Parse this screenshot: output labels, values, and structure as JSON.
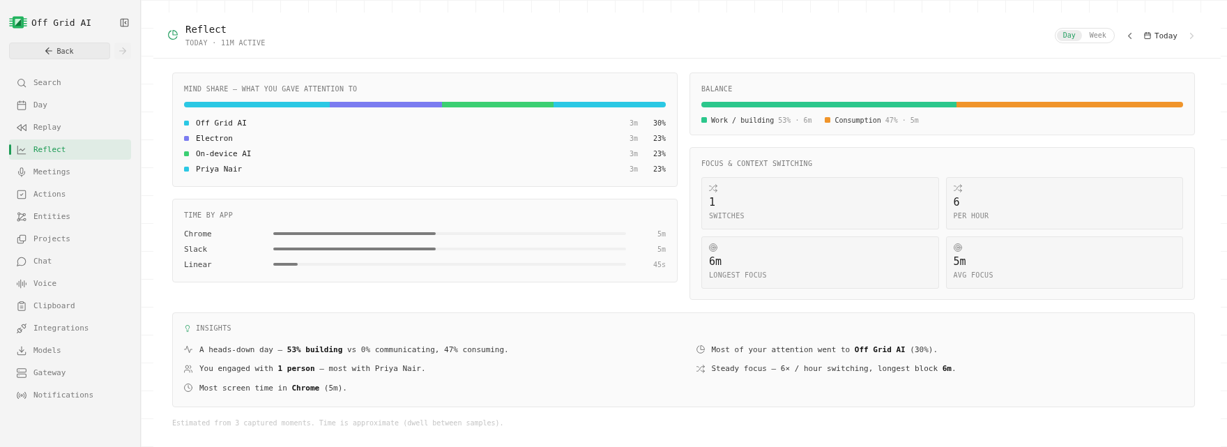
{
  "sidebar": {
    "app_name": "Off Grid AI",
    "back_button": {
      "label": "Back",
      "disabled": false
    },
    "forward_button": {
      "disabled": true
    },
    "items": [
      {
        "label": "Search",
        "selected": false
      },
      {
        "label": "Day",
        "selected": false
      },
      {
        "label": "Replay",
        "selected": false
      },
      {
        "label": "Reflect",
        "selected": true
      },
      {
        "label": "Meetings",
        "selected": false
      },
      {
        "label": "Actions",
        "selected": false
      },
      {
        "label": "Entities",
        "selected": false
      },
      {
        "label": "Projects",
        "selected": false
      },
      {
        "label": "Chat",
        "selected": false
      },
      {
        "label": "Voice",
        "selected": false
      },
      {
        "label": "Clipboard",
        "selected": false
      },
      {
        "label": "Integrations",
        "selected": false
      },
      {
        "label": "Models",
        "selected": false
      },
      {
        "label": "Gateway",
        "selected": false
      },
      {
        "label": "Notifications",
        "selected": false
      }
    ]
  },
  "header": {
    "title": "Reflect",
    "subtitle": "TODAY · 11M ACTIVE",
    "range_tabs": [
      {
        "label": "Day",
        "selected": true
      },
      {
        "label": "Week",
        "selected": false
      }
    ],
    "prev_button": {
      "disabled": false
    },
    "date_button": {
      "label": "Today"
    },
    "next_button": {
      "disabled": true
    }
  },
  "mind_share": {
    "title": "MIND SHARE — WHAT YOU GAVE ATTENTION TO",
    "items": [
      {
        "name": "Off Grid AI",
        "color": "#2bc8e4",
        "time": "3m",
        "share": "30%"
      },
      {
        "name": "Electron",
        "color": "#7b7cf0",
        "time": "3m",
        "share": "23%"
      },
      {
        "name": "On-device AI",
        "color": "#3ccf73",
        "time": "3m",
        "share": "23%"
      },
      {
        "name": "Priya Nair",
        "color": "#2bc8e4",
        "time": "3m",
        "share": "23%"
      }
    ]
  },
  "time_by_app": {
    "title": "TIME BY APP",
    "rows": [
      {
        "app": "Chrome",
        "level": 0.46,
        "duration": "5m"
      },
      {
        "app": "Slack",
        "level": 0.46,
        "duration": "5m"
      },
      {
        "app": "Linear",
        "level": 0.07,
        "duration": "45s"
      }
    ]
  },
  "balance": {
    "title": "BALANCE",
    "segments": [
      {
        "label": "Work / building",
        "detail": "53% · 6m",
        "color": "#2cc78c",
        "level": 0.53
      },
      {
        "label": "Consumption",
        "detail": "47% · 5m",
        "color": "#f0952b",
        "level": 0.47
      }
    ]
  },
  "focus": {
    "title": "FOCUS & CONTEXT SWITCHING",
    "stats": [
      {
        "kind": "switches",
        "value": "1",
        "label": "SWITCHES"
      },
      {
        "kind": "switches",
        "value": "6",
        "label": "PER HOUR"
      },
      {
        "kind": "focus",
        "value": "6m",
        "label": "LONGEST FOCUS"
      },
      {
        "kind": "focus",
        "value": "5m",
        "label": "AVG FOCUS"
      }
    ]
  },
  "insights": {
    "title": "INSIGHTS",
    "items": [
      {
        "kind": "activity",
        "text": "A heads-down day — **53% building** vs 0% communicating, 47% consuming."
      },
      {
        "kind": "attention",
        "text": "Most of your attention went to **Off Grid AI** (30%)."
      },
      {
        "kind": "people",
        "text": "You engaged with **1 person** — most with Priya Nair."
      },
      {
        "kind": "switching",
        "text": "Steady focus — 6× / hour switching, longest block **6m**."
      },
      {
        "kind": "time",
        "text": "Most screen time in **Chrome** (5m)."
      }
    ]
  },
  "footnote": "Estimated from 3 captured moments. Time is approximate (dwell between samples)."
}
